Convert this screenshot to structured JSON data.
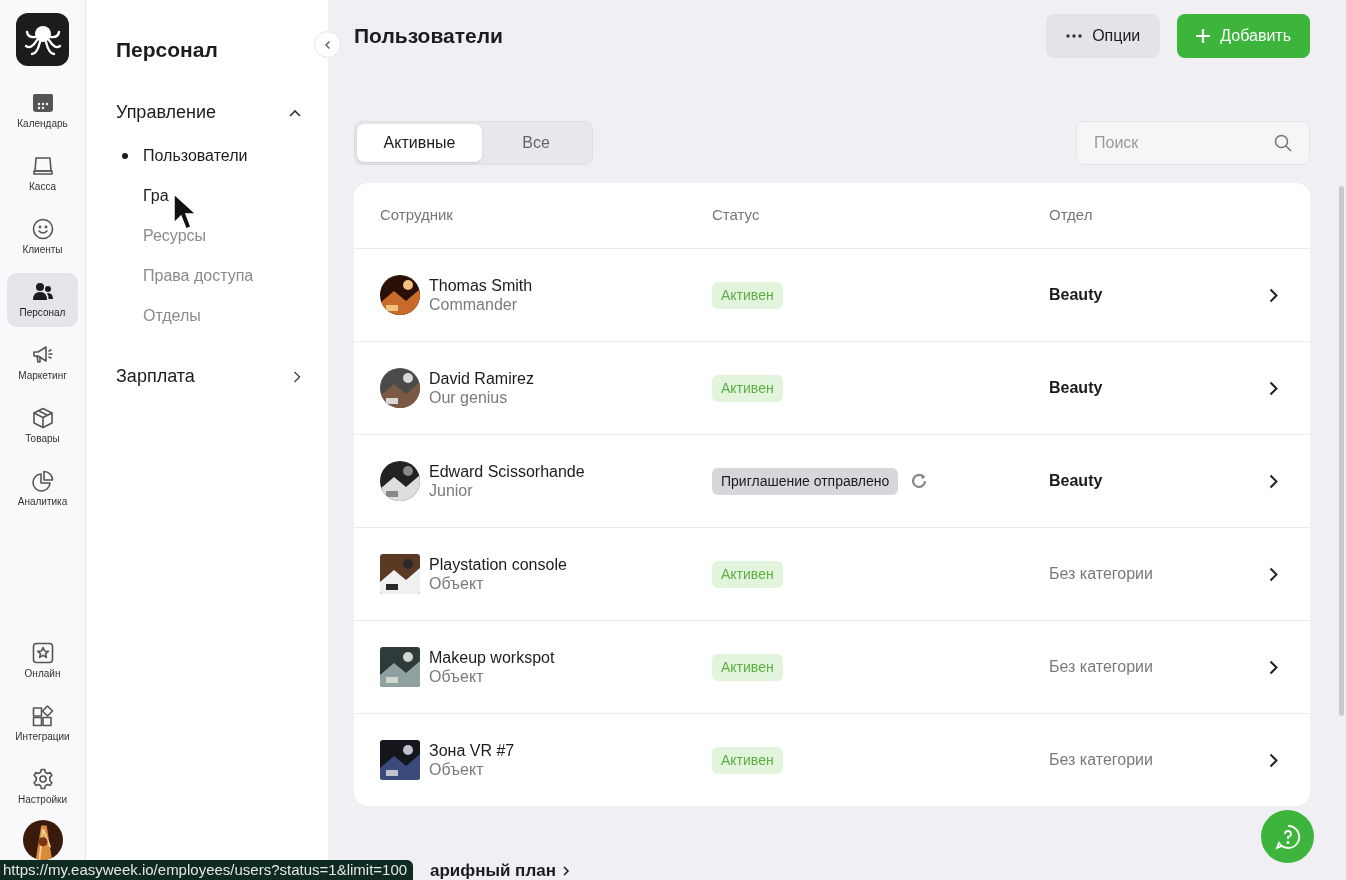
{
  "rail": [
    {
      "label": "Календарь",
      "selected": false
    },
    {
      "label": "Касса",
      "selected": false
    },
    {
      "label": "Клиенты",
      "selected": false
    },
    {
      "label": "Персонал",
      "selected": true
    },
    {
      "label": "Маркетинг",
      "selected": false
    },
    {
      "label": "Товары",
      "selected": false
    },
    {
      "label": "Аналитика",
      "selected": false
    }
  ],
  "rail_bottom": [
    {
      "label": "Онлайн",
      "selected": false
    },
    {
      "label": "Интеграции",
      "selected": false
    },
    {
      "label": "Настройки",
      "selected": false
    }
  ],
  "sidebar": {
    "title": "Персонал",
    "sections": [
      {
        "label": "Управление",
        "expanded": true,
        "children": [
          {
            "label": "Пользователи",
            "selected": true,
            "hovered": false
          },
          {
            "label": "Гра",
            "selected": false,
            "hovered": true
          },
          {
            "label": "Ресурсы",
            "selected": false,
            "hovered": false
          },
          {
            "label": "Права доступа",
            "selected": false,
            "hovered": false
          },
          {
            "label": "Отделы",
            "selected": false,
            "hovered": false
          }
        ]
      },
      {
        "label": "Зарплата",
        "expanded": false
      }
    ]
  },
  "page": {
    "title": "Пользователи",
    "options_button": "Опции",
    "add_button": "Добавить"
  },
  "filters": [
    {
      "label": "Активные",
      "selected": true
    },
    {
      "label": "Все",
      "selected": false
    }
  ],
  "search": {
    "placeholder": "Поиск"
  },
  "table": {
    "columns": [
      "Сотрудник",
      "Статус",
      "Отдел"
    ],
    "rows": [
      {
        "kind": "person",
        "name": "Thomas Smith",
        "role": "Commander",
        "status": "Активен",
        "invited": false,
        "department": "Beauty",
        "muted": false
      },
      {
        "kind": "person",
        "name": "David Ramirez",
        "role": "Our genius",
        "status": "Активен",
        "invited": false,
        "department": "Beauty",
        "muted": false
      },
      {
        "kind": "person",
        "name": "Edward Scissorhande",
        "role": "Junior",
        "status": "Приглашение отправлено",
        "invited": true,
        "department": "Beauty",
        "muted": false
      },
      {
        "kind": "object",
        "name": "Playstation console",
        "role": "Объект",
        "status": "Активен",
        "invited": false,
        "department": "Без категории",
        "muted": true
      },
      {
        "kind": "object",
        "name": "Makeup workspot",
        "role": "Объект",
        "status": "Активен",
        "invited": false,
        "department": "Без категории",
        "muted": true
      },
      {
        "kind": "object",
        "name": "Зона VR #7",
        "role": "Объект",
        "status": "Активен",
        "invited": false,
        "department": "Без категории",
        "muted": true
      }
    ]
  },
  "footer_link": "арифный план",
  "status_url": "https://my.easyweek.io/employees/users?status=1&limit=100"
}
